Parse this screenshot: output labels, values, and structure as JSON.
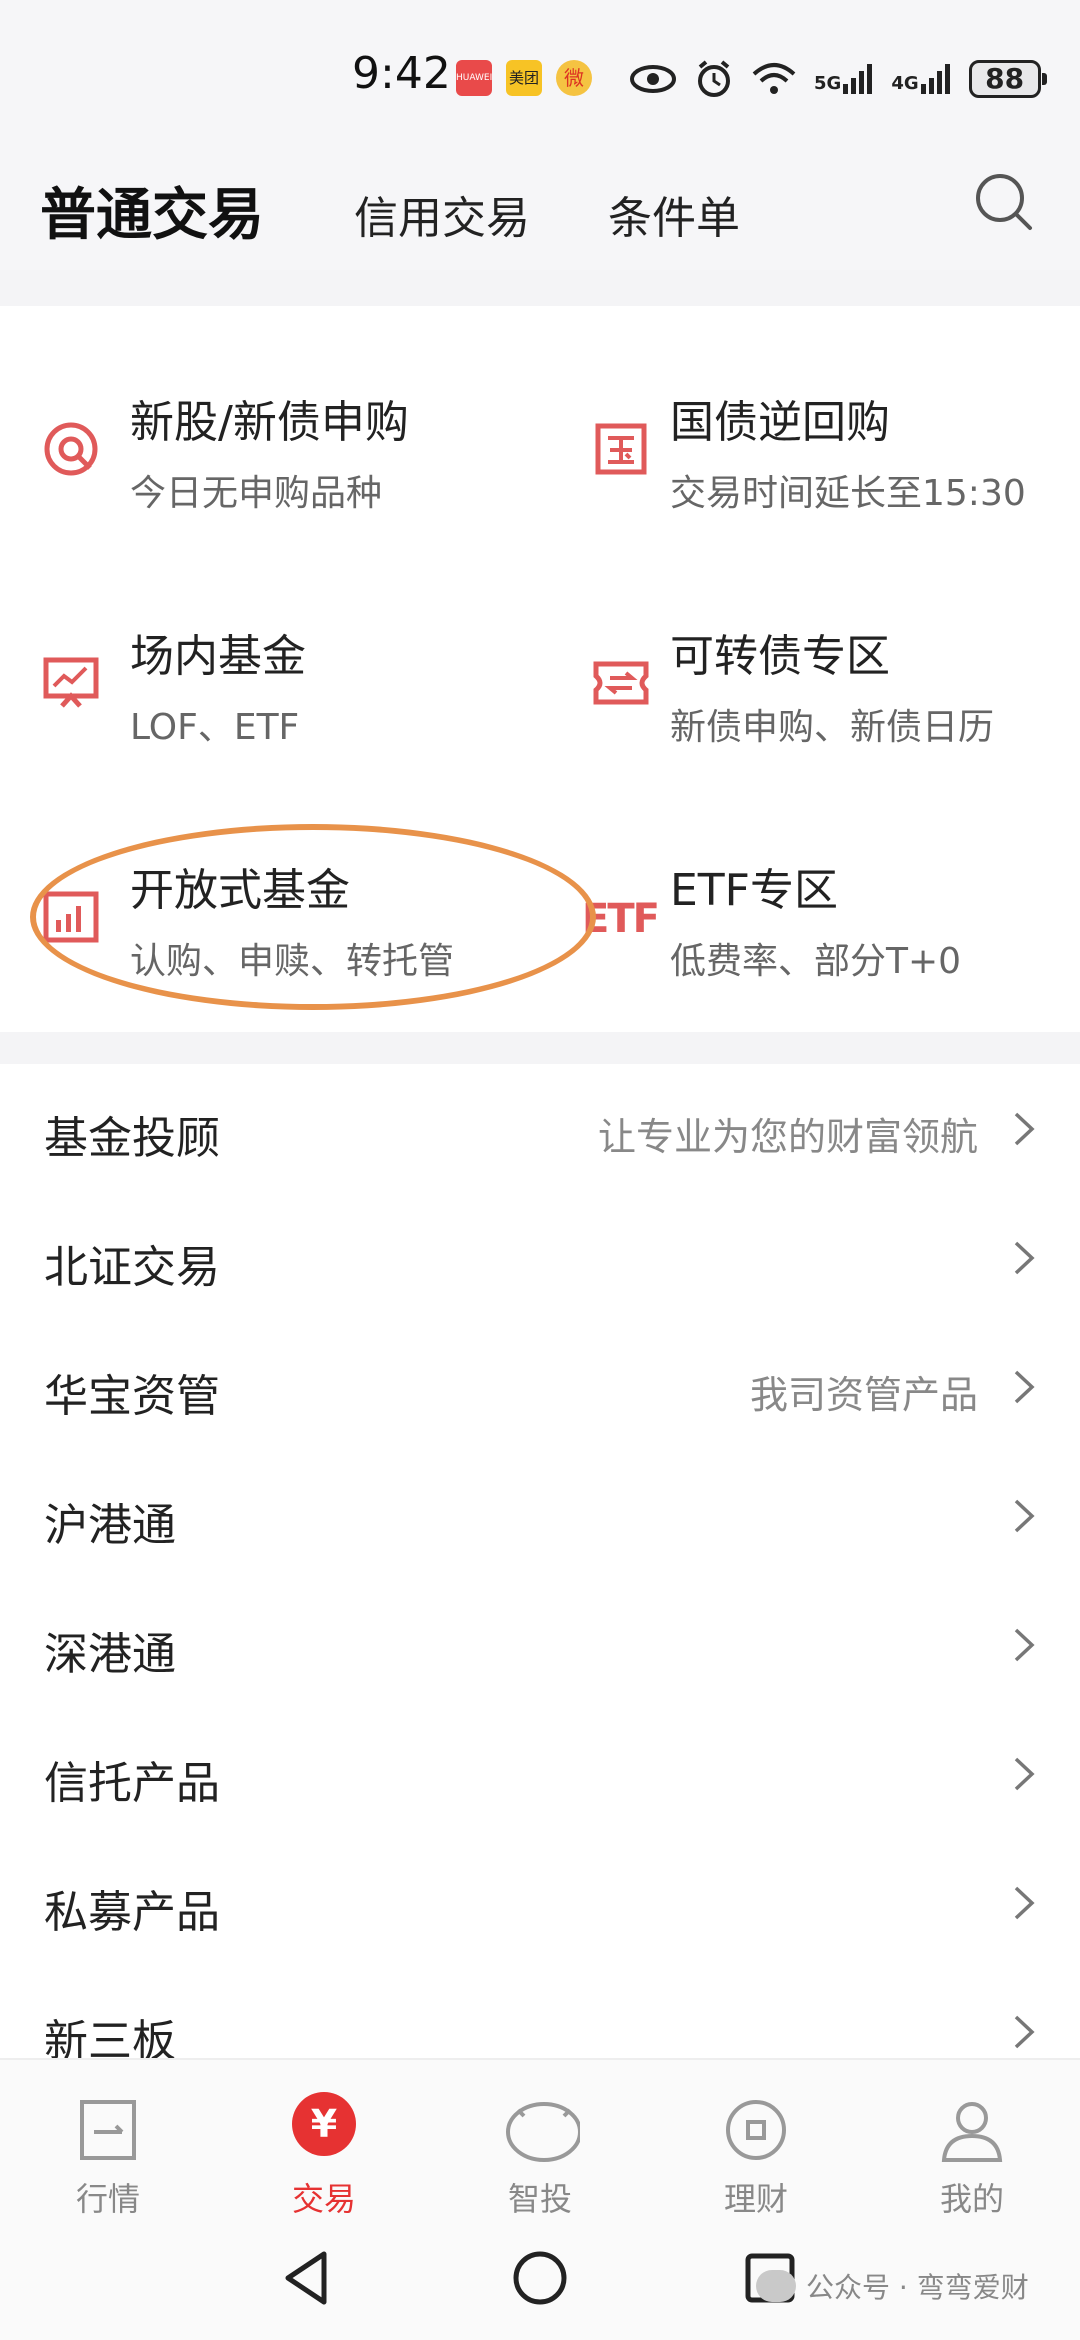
{
  "status_bar": {
    "time": "9:42",
    "app_icons": [
      "HUAWEI",
      "美团",
      "微"
    ],
    "signal_1": "5G",
    "signal_2": "4G",
    "battery": "88"
  },
  "header": {
    "tabs": [
      {
        "label": "普通交易",
        "active": true
      },
      {
        "label": "信用交易",
        "active": false
      },
      {
        "label": "条件单",
        "active": false
      }
    ],
    "search_icon": "search-icon"
  },
  "grid": [
    {
      "icon": "new-share-icon",
      "title": "新股/新债申购",
      "subtitle": "今日无申购品种"
    },
    {
      "icon": "treasury-icon",
      "title": "国债逆回购",
      "subtitle": "交易时间延长至15:30"
    },
    {
      "icon": "fund-monitor-icon",
      "title": "场内基金",
      "subtitle": "LOF、ETF"
    },
    {
      "icon": "convertible-bond-icon",
      "title": "可转债专区",
      "subtitle": "新债申购、新债日历"
    },
    {
      "icon": "bar-chart-icon",
      "title": "开放式基金",
      "subtitle": "认购、申赎、转托管"
    },
    {
      "icon": "etf-icon",
      "icon_text": "ETF",
      "title": "ETF专区",
      "subtitle": "低费率、部分T+0"
    }
  ],
  "list": [
    {
      "label": "基金投顾",
      "desc": "让专业为您的财富领航"
    },
    {
      "label": "北证交易",
      "desc": ""
    },
    {
      "label": "华宝资管",
      "desc": "我司资管产品"
    },
    {
      "label": "沪港通",
      "desc": ""
    },
    {
      "label": "深港通",
      "desc": ""
    },
    {
      "label": "信托产品",
      "desc": ""
    },
    {
      "label": "私募产品",
      "desc": ""
    },
    {
      "label": "新三板",
      "desc": ""
    }
  ],
  "tabbar": [
    {
      "label": "行情",
      "icon": "market-icon",
      "active": false
    },
    {
      "label": "交易",
      "icon": "yuan-icon",
      "icon_text": "¥",
      "active": true
    },
    {
      "label": "智投",
      "icon": "smart-invest-icon",
      "active": false
    },
    {
      "label": "理财",
      "icon": "wealth-icon",
      "active": false
    },
    {
      "label": "我的",
      "icon": "profile-icon",
      "active": false
    }
  ],
  "watermark": "公众号 · 弯弯爱财",
  "colors": {
    "accent": "#e63232",
    "icon_red": "#e05a5a",
    "highlight": "#e8924a",
    "header_bg": "#f6f6f8"
  }
}
